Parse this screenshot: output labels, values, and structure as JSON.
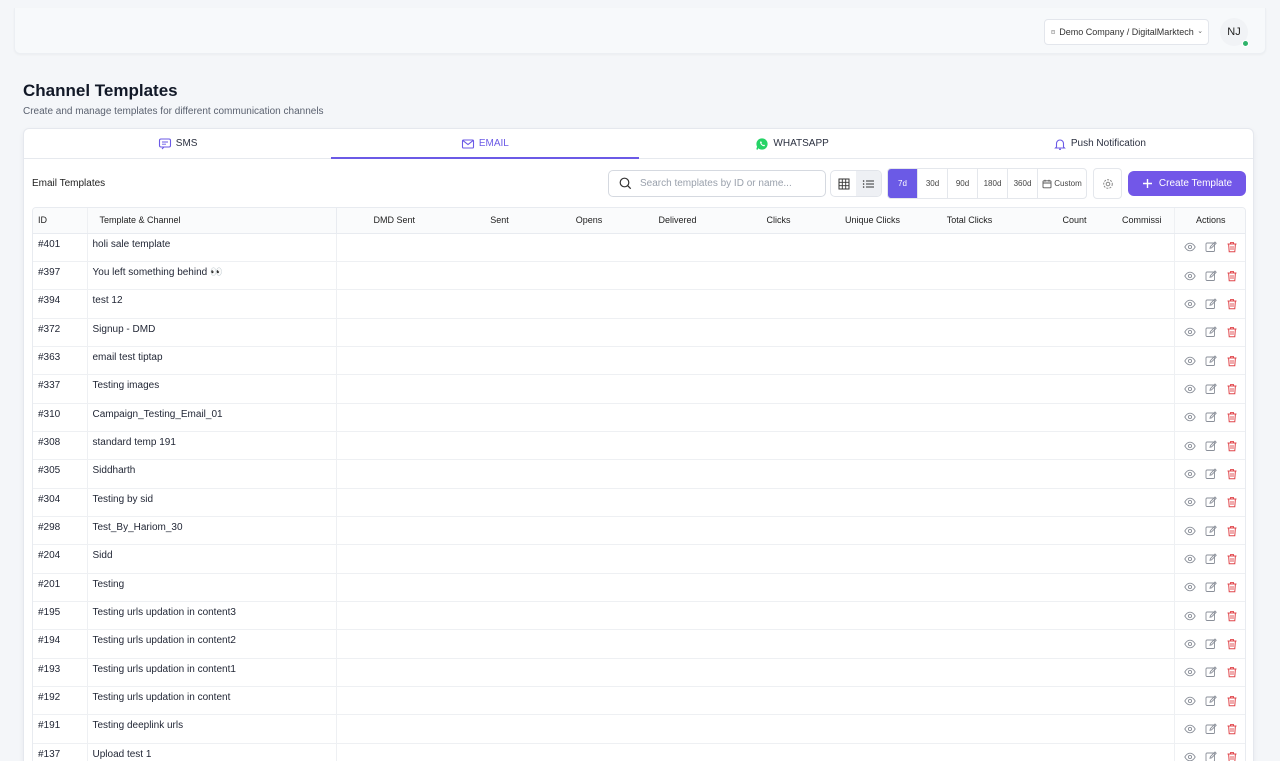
{
  "header": {
    "org_label": "Demo Company / DigitalMarktech",
    "avatar_initials": "NJ",
    "status_color": "#2fb36b"
  },
  "page": {
    "title": "Channel Templates",
    "subtitle": "Create and manage templates for different communication channels"
  },
  "tabs": [
    {
      "label": "SMS",
      "icon": "message-icon",
      "active": false
    },
    {
      "label": "EMAIL",
      "icon": "mail-icon",
      "active": true
    },
    {
      "label": "WHATSAPP",
      "icon": "whatsapp-icon",
      "active": false
    },
    {
      "label": "Push Notification",
      "icon": "bell-icon",
      "active": false
    }
  ],
  "toolbar": {
    "section_label": "Email Templates",
    "search_placeholder": "Search templates by ID or name...",
    "ranges": [
      "7d",
      "30d",
      "90d",
      "180d",
      "360d"
    ],
    "custom_label": "Custom",
    "create_label": "Create Template",
    "accent_color": "#7257e8"
  },
  "table": {
    "columns": [
      "ID",
      "Template & Channel",
      "DMD Sent",
      "Sent",
      "Opens",
      "Delivered",
      "Clicks",
      "Unique Clicks",
      "Total Clicks",
      "Count",
      "Commissi",
      "Actions"
    ],
    "rows": [
      {
        "id": "#401",
        "name": "holi sale template"
      },
      {
        "id": "#397",
        "name": "You left something behind 👀"
      },
      {
        "id": "#394",
        "name": "test 12"
      },
      {
        "id": "#372",
        "name": "Signup - DMD"
      },
      {
        "id": "#363",
        "name": "email test tiptap"
      },
      {
        "id": "#337",
        "name": "Testing images"
      },
      {
        "id": "#310",
        "name": "Campaign_Testing_Email_01"
      },
      {
        "id": "#308",
        "name": "standard temp 191"
      },
      {
        "id": "#305",
        "name": "Siddharth"
      },
      {
        "id": "#304",
        "name": "Testing by sid"
      },
      {
        "id": "#298",
        "name": "Test_By_Hariom_30"
      },
      {
        "id": "#204",
        "name": "Sidd"
      },
      {
        "id": "#201",
        "name": "Testing"
      },
      {
        "id": "#195",
        "name": "Testing urls updation in content3"
      },
      {
        "id": "#194",
        "name": "Testing urls updation in content2"
      },
      {
        "id": "#193",
        "name": "Testing urls updation in content1"
      },
      {
        "id": "#192",
        "name": "Testing urls updation in content"
      },
      {
        "id": "#191",
        "name": "Testing deeplink urls"
      },
      {
        "id": "#137",
        "name": "Upload test 1"
      }
    ]
  }
}
